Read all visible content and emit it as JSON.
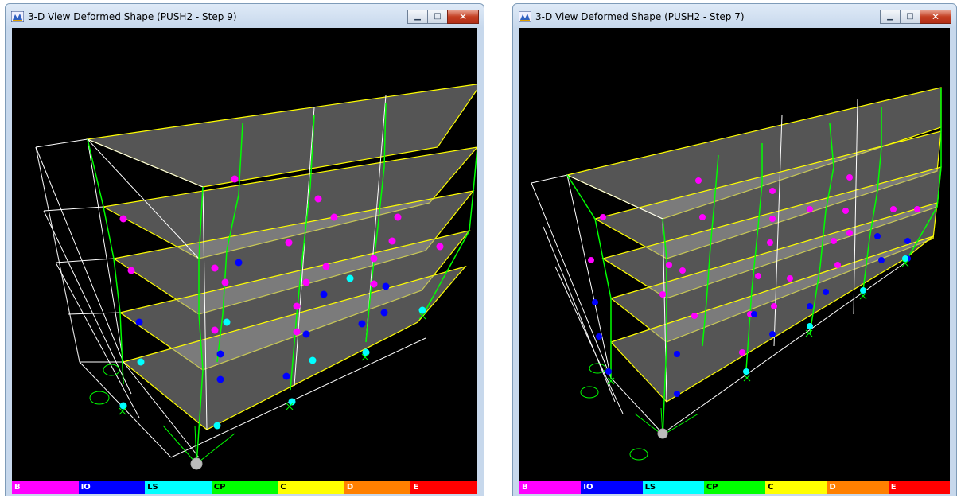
{
  "windows": [
    {
      "id": "left",
      "title": "3-D View  Deformed Shape (PUSH2 - Step 9)",
      "controls": {
        "minimize": "▁",
        "maximize": "□",
        "close": "✕"
      }
    },
    {
      "id": "right",
      "title": "3-D View  Deformed Shape (PUSH2 - Step 7)",
      "controls": {
        "minimize": "▁",
        "maximize": "□",
        "close": "✕"
      }
    }
  ],
  "legend": [
    {
      "label": "B",
      "color": "#ff00ff"
    },
    {
      "label": "IO",
      "color": "#0000ff"
    },
    {
      "label": "LS",
      "color": "#00ffff"
    },
    {
      "label": "CP",
      "color": "#00ff00"
    },
    {
      "label": "C",
      "color": "#ffff00"
    },
    {
      "label": "D",
      "color": "#ff8000"
    },
    {
      "label": "E",
      "color": "#ff0000"
    }
  ],
  "colors": {
    "beam": "#ffff00",
    "column": "#00ff00",
    "grid": "#ffffff",
    "slab": "#9a9a9a",
    "viewport_bg": "#000000"
  }
}
